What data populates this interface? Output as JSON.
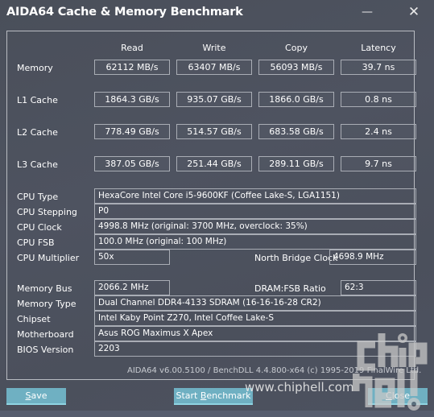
{
  "window": {
    "title": "AIDA64 Cache & Memory Benchmark",
    "minimize_glyph": "—",
    "close_glyph": "✕"
  },
  "columns": [
    "Read",
    "Write",
    "Copy",
    "Latency"
  ],
  "rows": [
    {
      "label": "Memory",
      "read": "62112 MB/s",
      "write": "63407 MB/s",
      "copy": "56093 MB/s",
      "latency": "39.7 ns"
    },
    {
      "label": "L1 Cache",
      "read": "1864.3 GB/s",
      "write": "935.07 GB/s",
      "copy": "1866.0 GB/s",
      "latency": "0.8 ns"
    },
    {
      "label": "L2 Cache",
      "read": "778.49 GB/s",
      "write": "514.57 GB/s",
      "copy": "683.58 GB/s",
      "latency": "2.4 ns"
    },
    {
      "label": "L3 Cache",
      "read": "387.05 GB/s",
      "write": "251.44 GB/s",
      "copy": "289.11 GB/s",
      "latency": "9.7 ns"
    }
  ],
  "cpu": {
    "type_label": "CPU Type",
    "type": "HexaCore Intel Core i5-9600KF  (Coffee Lake-S, LGA1151)",
    "stepping_label": "CPU Stepping",
    "stepping": "P0",
    "clock_label": "CPU Clock",
    "clock": "4998.8 MHz  (original: 3700 MHz, overclock: 35%)",
    "fsb_label": "CPU FSB",
    "fsb": "100.0 MHz  (original: 100 MHz)",
    "multiplier_label": "CPU Multiplier",
    "multiplier": "50x",
    "nb_clock_label": "North Bridge Clock",
    "nb_clock": "4698.9 MHz"
  },
  "memory": {
    "bus_label": "Memory Bus",
    "bus": "2066.2 MHz",
    "ratio_label": "DRAM:FSB Ratio",
    "ratio": "62:3",
    "type_label": "Memory Type",
    "type": "Dual Channel DDR4-4133 SDRAM  (16-16-16-28 CR2)",
    "chipset_label": "Chipset",
    "chipset": "Intel Kaby Point Z270, Intel Coffee Lake-S",
    "motherboard_label": "Motherboard",
    "motherboard": "Asus ROG Maximus X Apex",
    "bios_label": "BIOS Version",
    "bios": "2203"
  },
  "footer": "AIDA64 v6.00.5100 / BenchDLL 4.4.800-x64  (c) 1995-2019 FinalWire Ltd.",
  "buttons": {
    "save_pre": "",
    "save_u": "S",
    "save_post": "ave",
    "start_pre": "Start ",
    "start_u": "B",
    "start_post": "enchmark",
    "close_pre": "",
    "close_u": "C",
    "close_post": "lose"
  },
  "watermark": {
    "url": "www.chiphell.com",
    "logo": "chip hell"
  }
}
